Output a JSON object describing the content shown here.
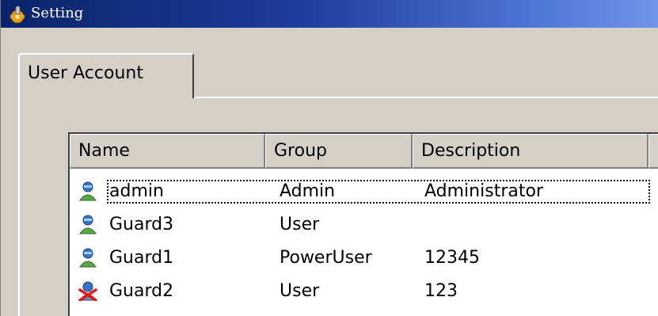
{
  "window": {
    "title": "Setting",
    "icon": "app-gear-icon"
  },
  "tabs": [
    {
      "label": "User Account",
      "active": true
    }
  ],
  "user_list": {
    "columns": [
      "Name",
      "Group",
      "Description"
    ],
    "rows": [
      {
        "name": "admin",
        "group": "Admin",
        "description": "Administrator",
        "icon": "user-icon",
        "focused": true
      },
      {
        "name": "Guard3",
        "group": "User",
        "description": "",
        "icon": "user-icon",
        "focused": false
      },
      {
        "name": "Guard1",
        "group": "PowerUser",
        "description": "12345",
        "icon": "user-icon",
        "focused": false
      },
      {
        "name": "Guard2",
        "group": "User",
        "description": "123",
        "icon": "user-disabled-icon",
        "focused": false
      }
    ]
  },
  "colors": {
    "titlebar_start": "#0a246a",
    "titlebar_end": "#6f95e8",
    "face": "#d4d0c8"
  }
}
